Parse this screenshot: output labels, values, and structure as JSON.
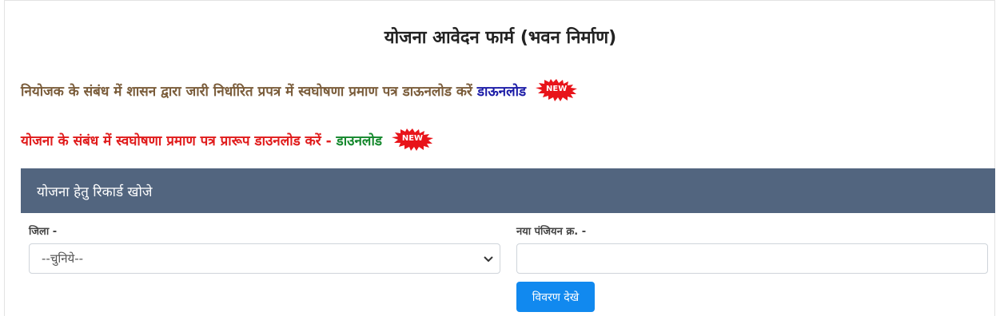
{
  "page": {
    "title": "योजना आवेदन फार्म (भवन निर्माण)"
  },
  "notices": {
    "employer_text": "नियोजक के संबंध में शासन द्वारा जारी निर्धारित प्रपत्र में स्वघोषणा प्रमाण पत्र डाऊनलोड करें",
    "employer_link": "डाऊनलोड",
    "scheme_text": "योजना के संबंध में स्वघोषणा प्रमाण पत्र प्रारूप डाउनलोड करें -",
    "scheme_link": "डाउनलोड",
    "new_badge": "NEW"
  },
  "search_panel": {
    "heading": "योजना हेतु रिकार्ड खोजे",
    "district_label": "जिला -",
    "district_selected": "--चुनिये--",
    "registration_label": "नया पंजियन क्र. -",
    "registration_value": "",
    "submit_label": "विवरण देखे"
  },
  "colors": {
    "panel_header": "#52657f",
    "button": "#1189ef",
    "notice1": "#7a5c3a",
    "notice2": "#e01b1b",
    "link_blue": "#1a1aa6",
    "link_green": "#13872b",
    "badge": "#e8141a"
  },
  "icons": {
    "select_arrow": "chevron-down-icon",
    "new_badge": "starburst-new-badge"
  }
}
